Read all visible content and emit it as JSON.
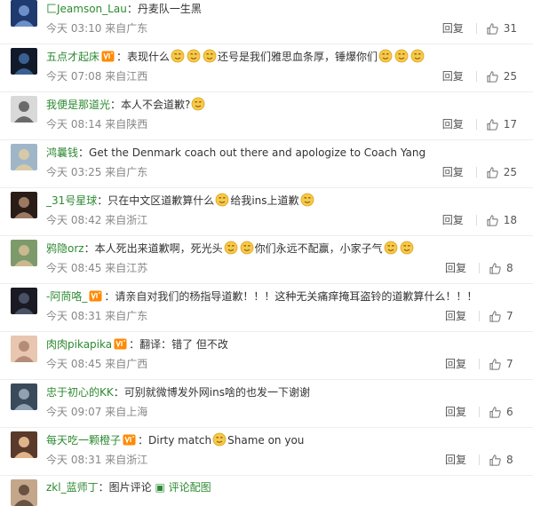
{
  "reply_label": "回复",
  "colors": {
    "username": "#2d8a31",
    "meta": "#888888",
    "text": "#333333"
  },
  "comments": [
    {
      "user": "匚Jeamson_Lau",
      "badge": false,
      "text": "丹麦队一生黑",
      "time": "今天 03:10",
      "location": "来自广东",
      "likes": "31",
      "avatar": [
        "#1f3a6e",
        "#6d8fc9"
      ]
    },
    {
      "user": "五点才起床",
      "badge": true,
      "text": "表现什么",
      "emoji_after_1": 3,
      "text2": "还号是我们雅思血条厚，锤爆你们",
      "emoji_after_2": 3,
      "time": "今天 07:08",
      "location": "来自江西",
      "likes": "25",
      "avatar": [
        "#121a2a",
        "#3c5f92"
      ]
    },
    {
      "user": "我便是那道光",
      "badge": false,
      "text": "本人不会道歉?",
      "emoji_after_1": 1,
      "time": "今天 08:14",
      "location": "来自陕西",
      "likes": "17",
      "avatar": [
        "#d9d9d9",
        "#6a6a6a"
      ]
    },
    {
      "user": "鸿曩钱",
      "badge": false,
      "text": "Get the Denmark coach out there and apologize to Coach Yang",
      "time": "今天 03:25",
      "location": "来自广东",
      "likes": "25",
      "avatar": [
        "#9fb6c8",
        "#d8c9a8"
      ]
    },
    {
      "user": "_31号星球",
      "badge": false,
      "text": "只在中文区道歉算什么",
      "emoji_after_1": 1,
      "text2": "给我ins上道歉",
      "emoji_after_2": 1,
      "time": "今天 08:42",
      "location": "来自浙江",
      "likes": "18",
      "avatar": [
        "#2a1d18",
        "#9c7a62"
      ]
    },
    {
      "user": "鸦隐orz",
      "badge": false,
      "text": "本人死出来道歉啊，死光头",
      "emoji_after_1": 2,
      "text2": "你们永远不配赢，小家子气",
      "emoji_after_2": 2,
      "time": "今天 08:45",
      "location": "来自江苏",
      "likes": "8",
      "avatar": [
        "#7c9a6a",
        "#c9b98e"
      ]
    },
    {
      "user": "-阿茼咯_",
      "badge": true,
      "text": "请亲自对我们的杨指导道歉！！！这种无关痛痒掩耳盗铃的道歉算什么！！！",
      "time": "今天 08:31",
      "location": "来自广东",
      "likes": "7",
      "avatar": [
        "#1a1a22",
        "#4a5066"
      ]
    },
    {
      "user": "肉肉pikapika",
      "badge": true,
      "text": "翻译：错了 但不改",
      "time": "今天 08:45",
      "location": "来自广西",
      "likes": "7",
      "avatar": [
        "#e8c6b0",
        "#b58c7a"
      ]
    },
    {
      "user": "忠于初心的KK",
      "badge": false,
      "text": "可别就微博发外网ins啥的也发一下谢谢",
      "time": "今天 09:07",
      "location": "来自上海",
      "likes": "6",
      "avatar": [
        "#3a4a5a",
        "#8fa1b2"
      ]
    },
    {
      "user": "每天吃一颗橙子",
      "badge": true,
      "text": "Dirty match",
      "emoji_after_1": 1,
      "text2": "Shame on you",
      "time": "今天 08:31",
      "location": "来自浙江",
      "likes": "8",
      "avatar": [
        "#5a3a2a",
        "#e0b48a"
      ]
    },
    {
      "user": "zkl_蓝师丁",
      "badge": false,
      "text": "图片评论",
      "link2": "评论配图",
      "time": "",
      "location": "",
      "likes": "",
      "avatar": [
        "#c4a78a",
        "#6a5242"
      ]
    }
  ]
}
